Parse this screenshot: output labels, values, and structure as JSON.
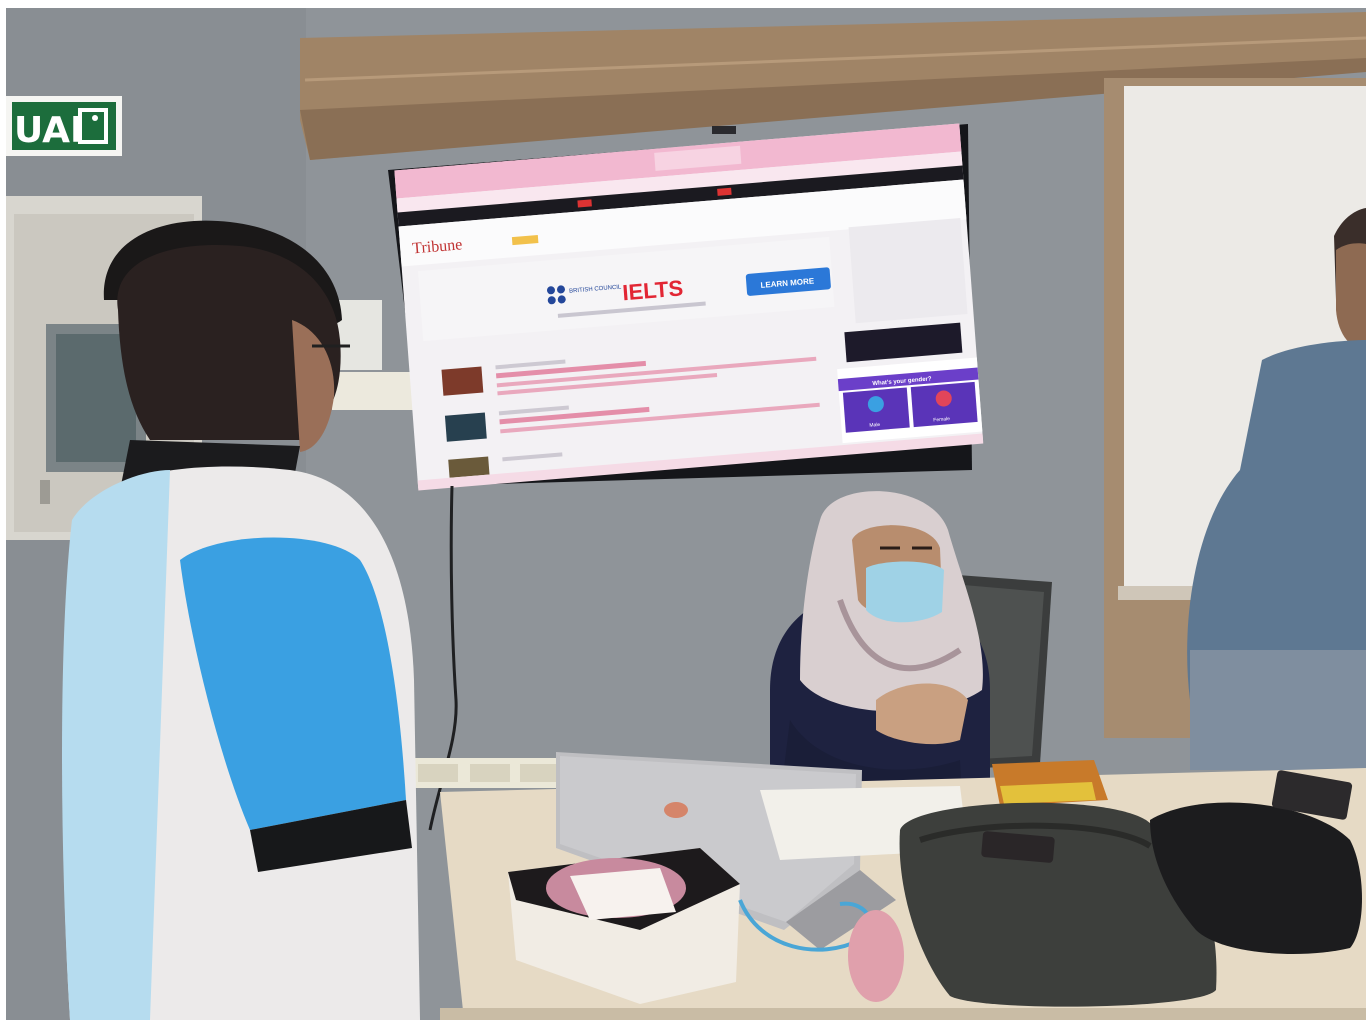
{
  "exit_sign": {
    "text": "UAR"
  },
  "tv_screen": {
    "site_logo": "Tribune",
    "ad_brand_org": "BRITISH COUNCIL",
    "ad_brand": "IELTS",
    "ad_button": "LEARN MORE",
    "popup_title": "What's your gender?",
    "popup_option_male": "Male",
    "popup_option_female": "Female"
  },
  "colors": {
    "wall": "#8d9297",
    "wood": "#9b7f63",
    "tv_frame": "#15161a",
    "screen_bg": "#f3f1f4",
    "browser_pink": "#f2b8d0",
    "ielts_red": "#e22634",
    "learn_more_blue": "#2b78d8",
    "popup_purple": "#6b3fc9",
    "desk": "#e8dcc8",
    "shirt_blue": "#3aa0e2"
  }
}
